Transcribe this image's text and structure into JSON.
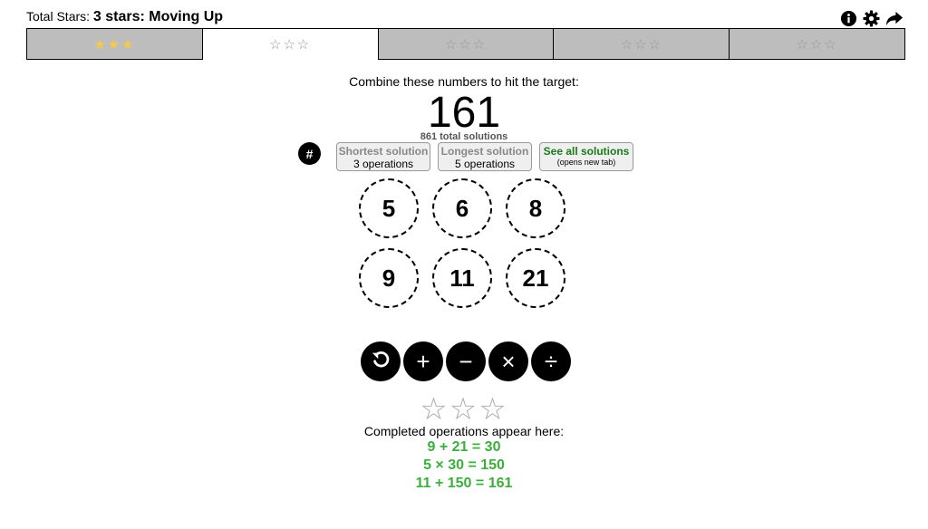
{
  "header": {
    "label": "Total Stars:",
    "value": "3 stars: Moving Up"
  },
  "icons": [
    "info-icon",
    "gear-icon",
    "share-icon"
  ],
  "tabs": [
    {
      "stars": "★★★",
      "filled": true
    },
    {
      "stars": "☆☆☆",
      "filled": false
    },
    {
      "stars": "☆☆☆",
      "filled": false
    },
    {
      "stars": "☆☆☆",
      "filled": false
    },
    {
      "stars": "☆☆☆",
      "filled": false
    }
  ],
  "game": {
    "prompt": "Combine these numbers to hit the target:",
    "target": "161",
    "solutions": "861 total solutions",
    "hash_label": "#"
  },
  "solution_buttons": {
    "shortest": {
      "title": "Shortest solution",
      "sub": "3 operations"
    },
    "longest": {
      "title": "Longest solution",
      "sub": "5 operations"
    },
    "all": {
      "title": "See all solutions",
      "sub": "(opens new tab)"
    }
  },
  "numbers": [
    "5",
    "6",
    "8",
    "9",
    "11",
    "21"
  ],
  "operators": {
    "undo": "↺",
    "add": "+",
    "subtract": "−",
    "multiply": "×",
    "divide": "÷"
  },
  "result_stars": "☆☆☆",
  "completed_label": "Completed operations appear here:",
  "operations": [
    "9 + 21 = 30",
    "5 × 30 = 150",
    "11 + 150 = 161"
  ],
  "colors": {
    "accent_green": "#3cae3c",
    "star_gold": "#f6c94a",
    "tab_gray": "#bdbdbd"
  }
}
